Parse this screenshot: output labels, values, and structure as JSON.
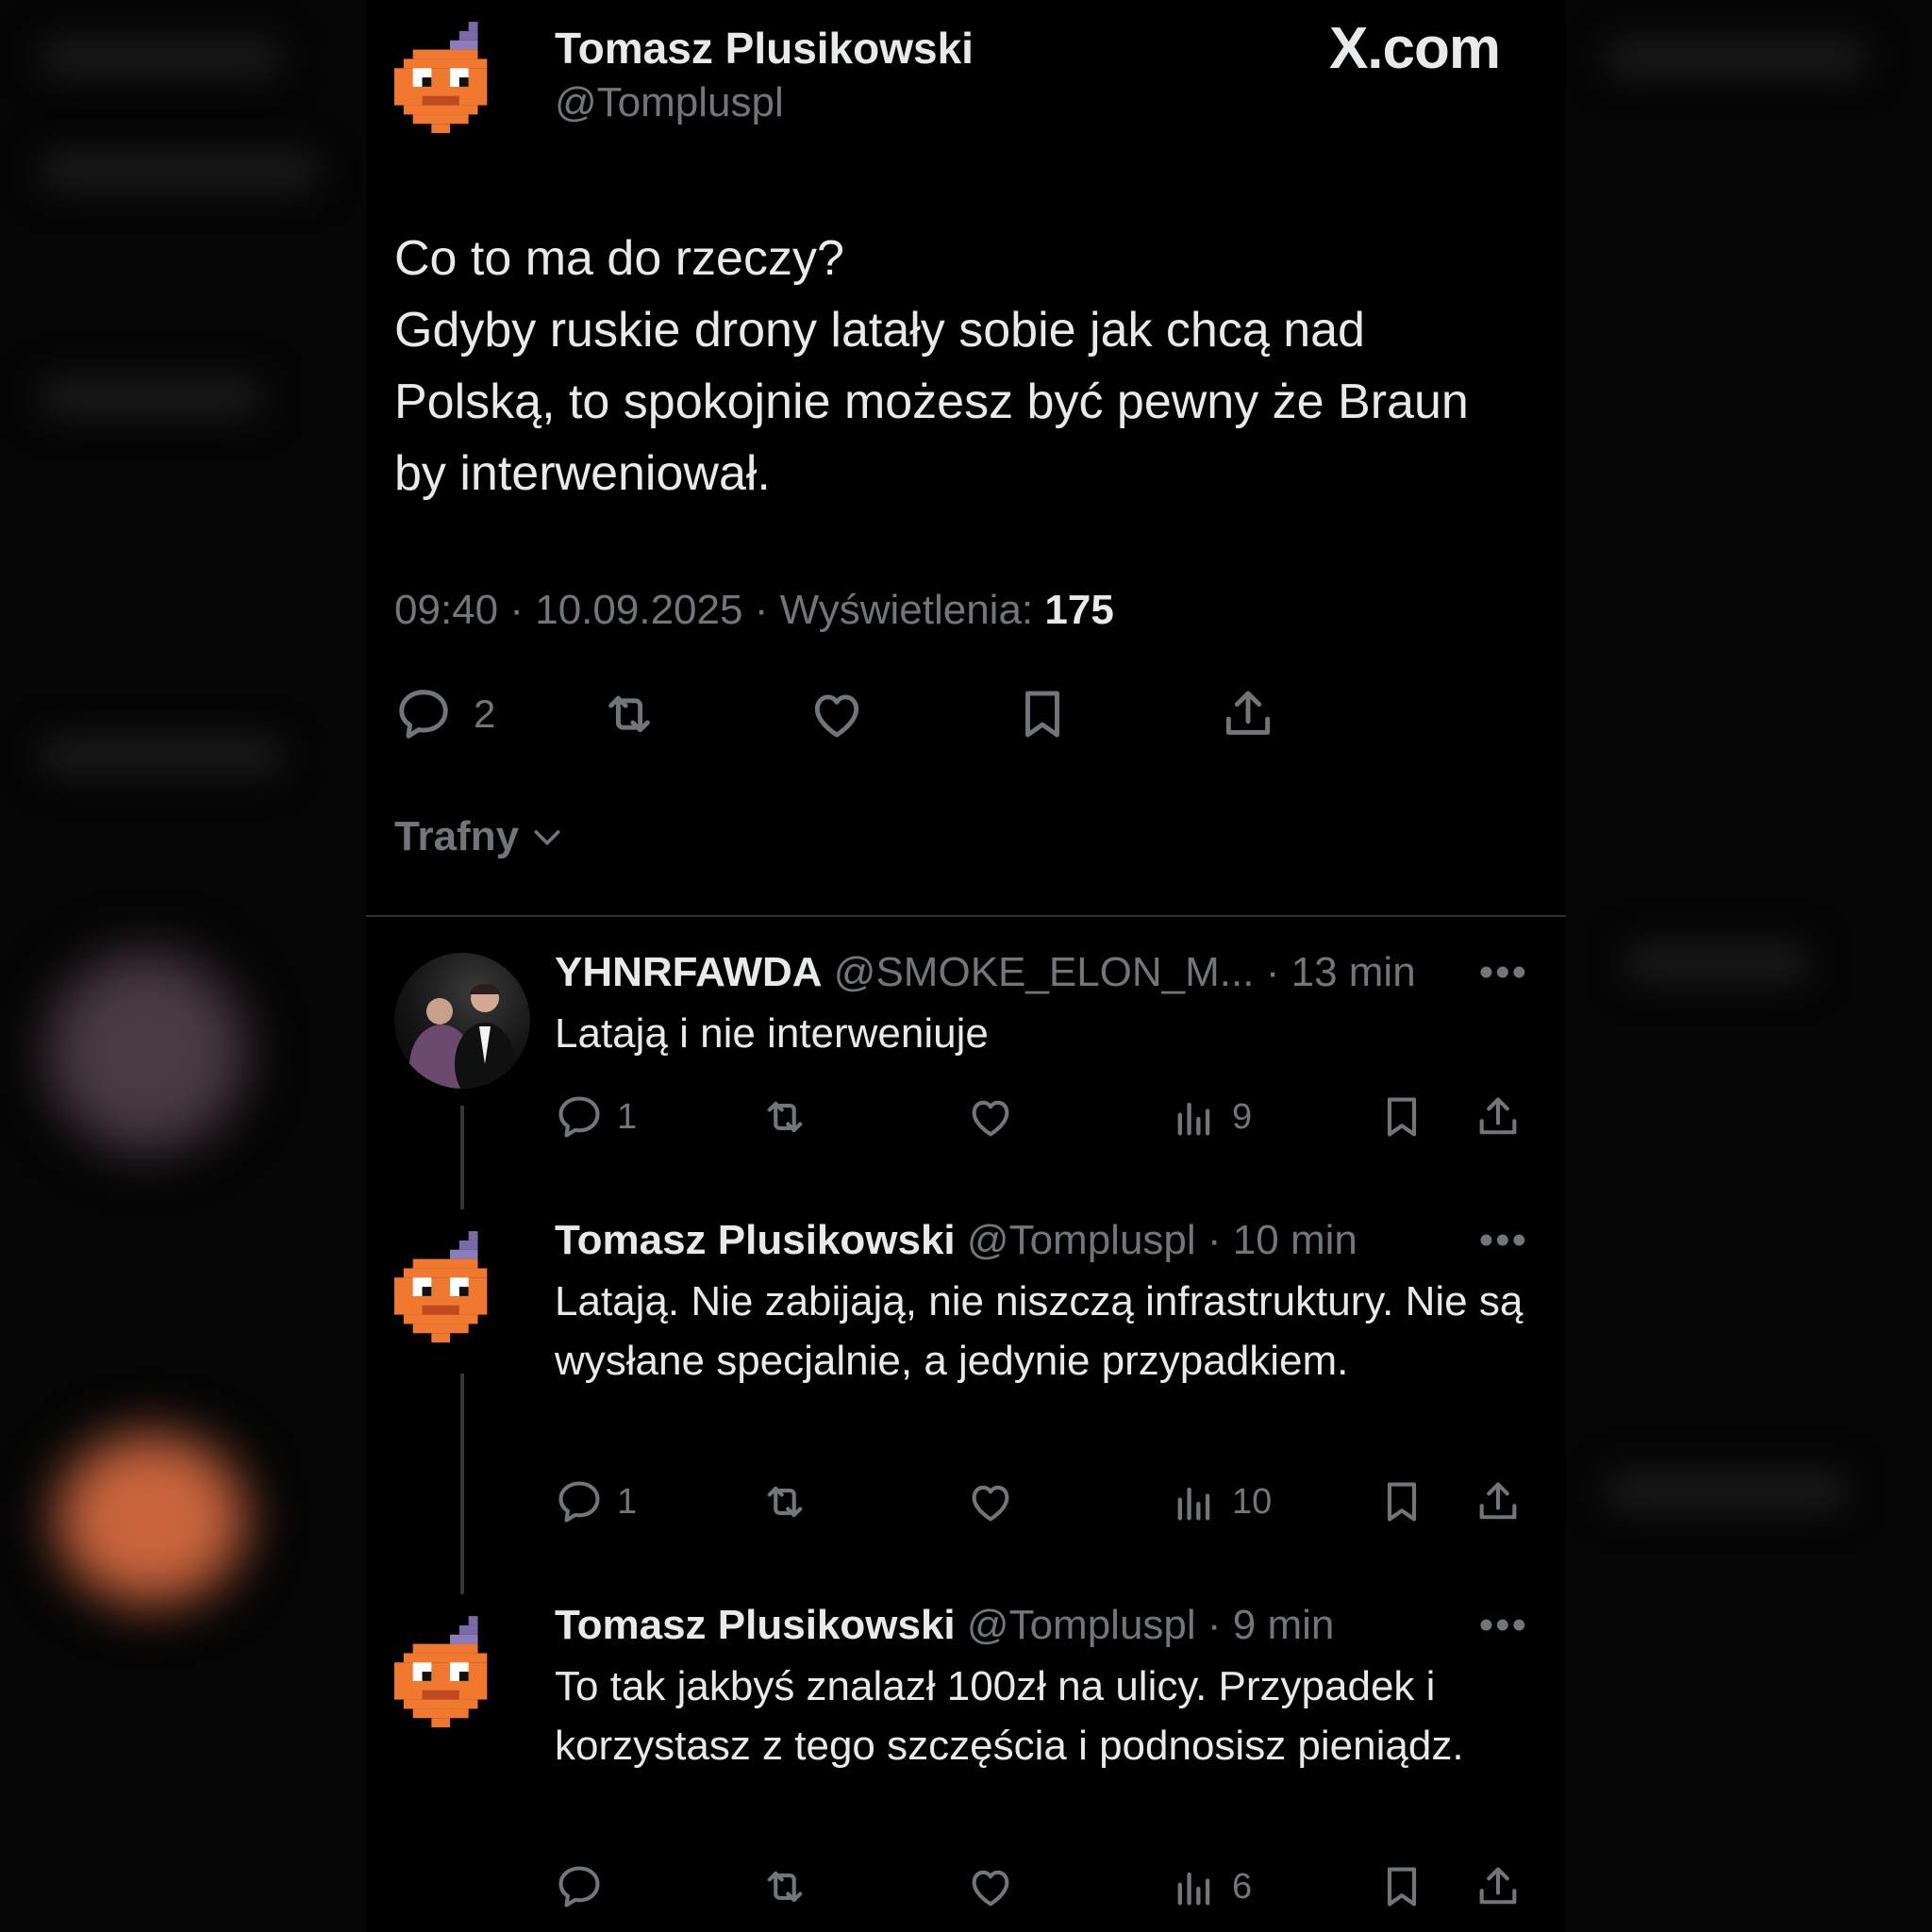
{
  "brand": "X.com",
  "post": {
    "author_name": "Tomasz Plusikowski",
    "author_handle": "@Tompluspl",
    "text_lines": [
      "Co to ma do rzeczy?",
      "Gdyby ruskie drony latały sobie jak chcą nad",
      "Polską, to spokojnie możesz być pewny że Braun",
      "by interweniował."
    ],
    "time": "09:40",
    "date": "10.09.2025",
    "views_label": "Wyświetlenia:",
    "views_count": "175",
    "reply_count": "2"
  },
  "sort_label": "Trafny",
  "replies": [
    {
      "name": "YHNRFAWDA",
      "handle": "@SMOKE_ELON_M...",
      "age": "13 min",
      "text": "Latają i nie interweniuje",
      "reply_count": "1",
      "views": "9"
    },
    {
      "name": "Tomasz Plusikowski",
      "handle": "@Tompluspl",
      "age": "10 min",
      "text": "Latają. Nie zabijają, nie niszczą infrastruktury. Nie są wysłane specjalnie, a jedynie przypadkiem.",
      "reply_count": "1",
      "views": "10"
    },
    {
      "name": "Tomasz Plusikowski",
      "handle": "@Tompluspl",
      "age": "9 min",
      "text": "To tak jakbyś znalazł 100zł na ulicy. Przypadek i korzystasz z tego szczęścia i podnosisz pieniądz.",
      "reply_count": "",
      "views": "6"
    }
  ],
  "more_glyph": "•••",
  "separator": "·",
  "colors": {
    "background": "#000000",
    "text": "#e7e9ea",
    "secondary": "#71767b",
    "avatar_orange": "#f0782f"
  }
}
